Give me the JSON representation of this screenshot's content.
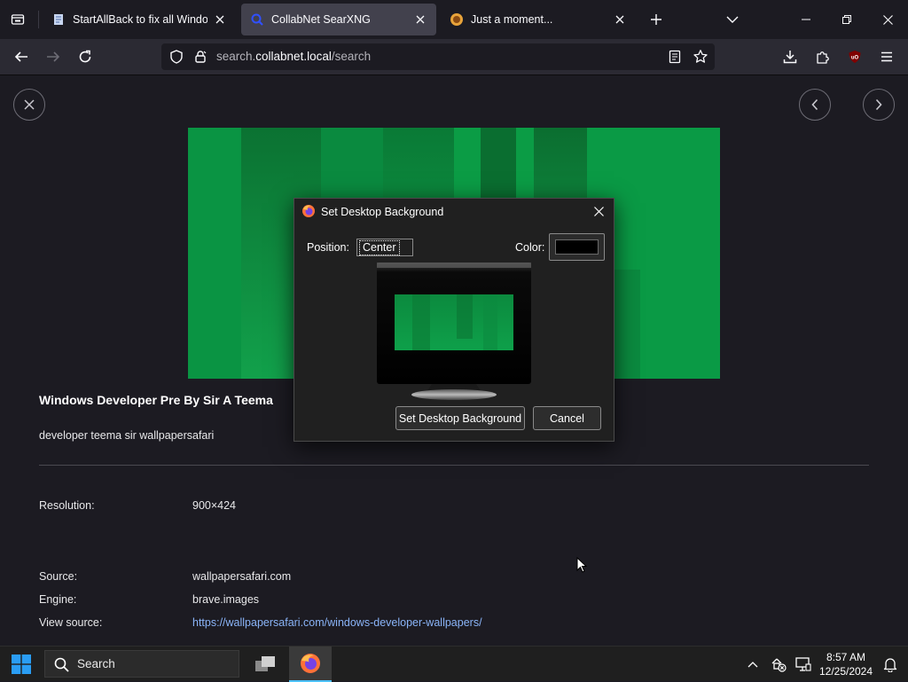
{
  "browser": {
    "tabs": [
      {
        "title": "StartAllBack to fix all Windows",
        "favicon": "document-icon",
        "active": false
      },
      {
        "title": "CollabNet SearXNG",
        "favicon": "searxng-icon",
        "active": true
      },
      {
        "title": "Just a moment...",
        "favicon": "cloudflare-icon",
        "active": false
      }
    ],
    "url": {
      "prefix": "search.",
      "host": "collabnet.local",
      "path": "/search"
    }
  },
  "page": {
    "image_title": "Windows Developer Pre By Sir A Teema",
    "image_description": "developer teema sir wallpapersafari",
    "details": [
      {
        "label": "Resolution:",
        "value": "900×424"
      },
      {
        "label": "Source:",
        "value": "wallpapersafari.com"
      },
      {
        "label": "Engine:",
        "value": "brave.images"
      },
      {
        "label": "View source:",
        "value": "https://wallpapersafari.com/windows-developer-wallpapers/"
      }
    ]
  },
  "dialog": {
    "title": "Set Desktop Background",
    "position_label": "Position:",
    "position_value": "Center",
    "color_label": "Color:",
    "color_value": "#000000",
    "set_button": "Set Desktop Background",
    "cancel_button": "Cancel"
  },
  "taskbar": {
    "search_placeholder": "Search",
    "time": "8:57 AM",
    "date": "12/25/2024"
  },
  "colors": {
    "wallpaper_green": "#0a9a45",
    "link": "#8ab4f8"
  }
}
